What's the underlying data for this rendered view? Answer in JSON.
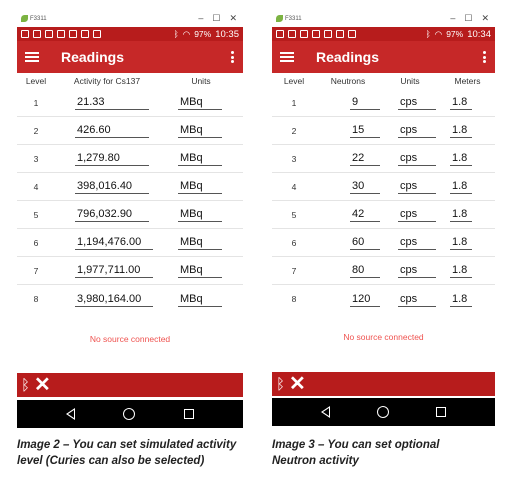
{
  "left": {
    "window_title": "F3311",
    "status_battery": "97%",
    "status_time": "10:35",
    "app_title": "Readings",
    "headers": [
      "Level",
      "Activity for Cs137",
      "Units"
    ],
    "rows": [
      {
        "level": "1",
        "value": "21.33",
        "unit": "MBq"
      },
      {
        "level": "2",
        "value": "426.60",
        "unit": "MBq"
      },
      {
        "level": "3",
        "value": "1,279.80",
        "unit": "MBq"
      },
      {
        "level": "4",
        "value": "398,016.40",
        "unit": "MBq"
      },
      {
        "level": "5",
        "value": "796,032.90",
        "unit": "MBq"
      },
      {
        "level": "6",
        "value": "1,194,476.00",
        "unit": "MBq"
      },
      {
        "level": "7",
        "value": "1,977,711.00",
        "unit": "MBq"
      },
      {
        "level": "8",
        "value": "3,980,164.00",
        "unit": "MBq"
      }
    ],
    "no_source": "No source connected",
    "caption_line1": "Image 2 – You can set simulated activity",
    "caption_line2": "level (Curies can also be selected)"
  },
  "right": {
    "window_title": "F3311",
    "status_battery": "97%",
    "status_time": "10:34",
    "app_title": "Readings",
    "headers": [
      "Level",
      "Neutrons",
      "Units",
      "Meters"
    ],
    "rows": [
      {
        "level": "1",
        "neutrons": "9",
        "unit": "cps",
        "meters": "1.8"
      },
      {
        "level": "2",
        "neutrons": "15",
        "unit": "cps",
        "meters": "1.8"
      },
      {
        "level": "3",
        "neutrons": "22",
        "unit": "cps",
        "meters": "1.8"
      },
      {
        "level": "4",
        "neutrons": "30",
        "unit": "cps",
        "meters": "1.8"
      },
      {
        "level": "5",
        "neutrons": "42",
        "unit": "cps",
        "meters": "1.8"
      },
      {
        "level": "6",
        "neutrons": "60",
        "unit": "cps",
        "meters": "1.8"
      },
      {
        "level": "7",
        "neutrons": "80",
        "unit": "cps",
        "meters": "1.8"
      },
      {
        "level": "8",
        "neutrons": "120",
        "unit": "cps",
        "meters": "1.8"
      }
    ],
    "no_source": "No source connected",
    "caption_line1": "Image 3 – You can set optional",
    "caption_line2": "Neutron activity"
  },
  "colors": {
    "status_bar": "#b71c1c",
    "app_bar": "#c62828",
    "no_source_text": "#ef5350",
    "nav_bar": "#000000"
  },
  "icons": {
    "window_min": "minimize-icon",
    "window_max": "maximize-icon",
    "window_close": "close-icon",
    "bluetooth": "bluetooth-icon",
    "disconnect": "x-icon"
  }
}
